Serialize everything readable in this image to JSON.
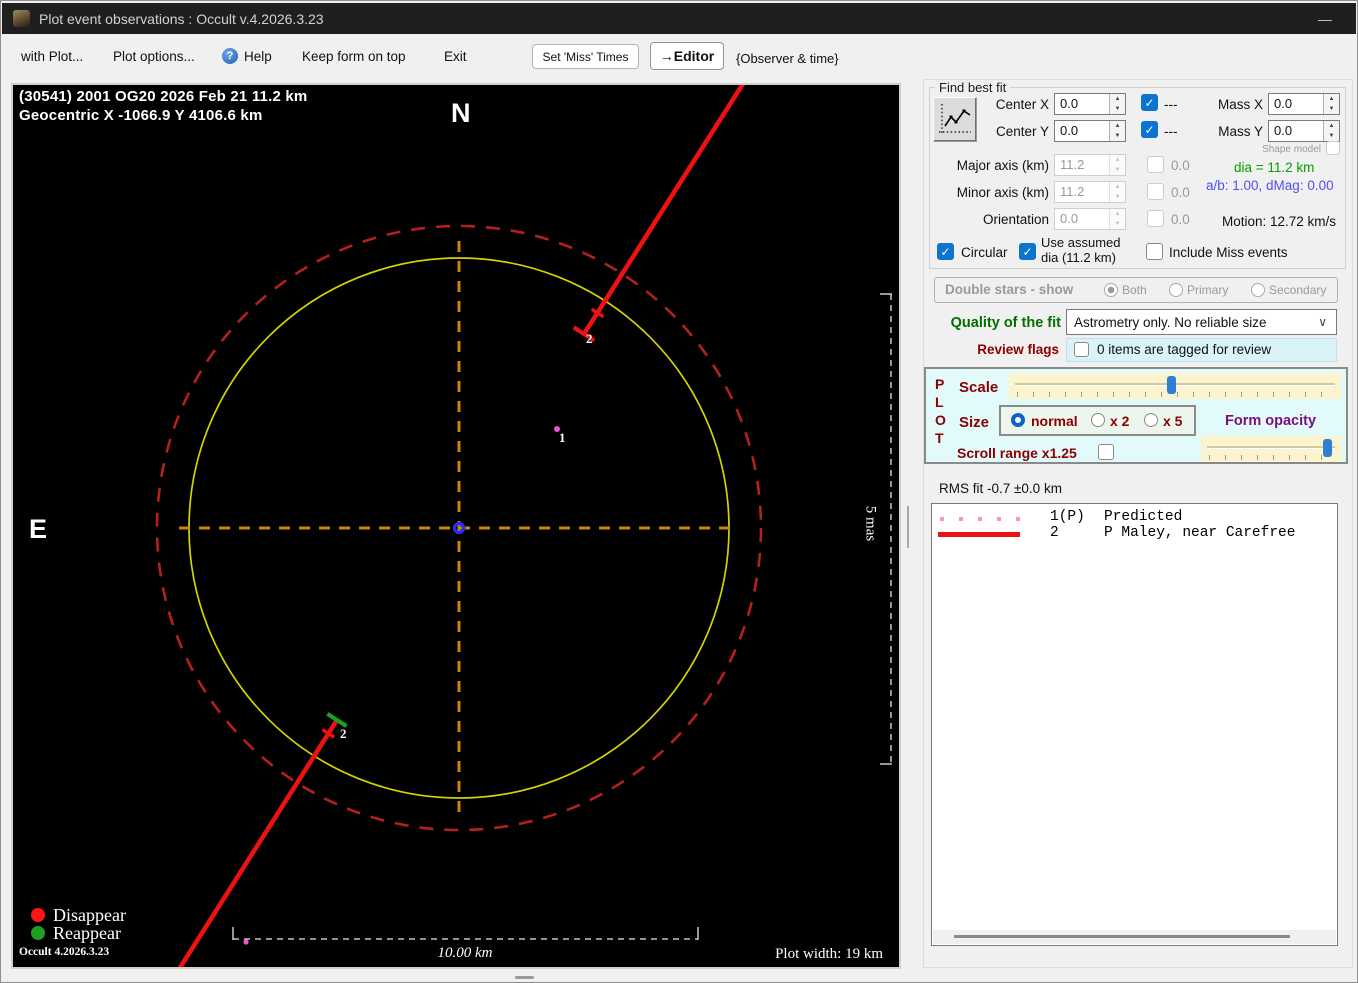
{
  "window": {
    "title": "Plot event observations : Occult v.4.2026.3.23",
    "minimize_glyph": "—"
  },
  "menu": {
    "with_plot": "with Plot...",
    "plot_options": "Plot options...",
    "help_glyph": "?",
    "help": "Help",
    "keep_on_top": "Keep form on top",
    "exit": "Exit",
    "set_miss_times": "Set 'Miss' Times",
    "editor": "→Editor",
    "observer_time": "{Observer & time}"
  },
  "plot": {
    "header_line1": "(30541) 2001 OG20  2026 Feb 21   11.2 km",
    "header_line2": "Geocentric X  -1066.9 Y 4106.6 km",
    "north_label": "N",
    "east_label": "E",
    "station1_label": "1",
    "chord2_label_upper": "2",
    "chord2_label_lower": "2",
    "mas_scale_label": "5 mas",
    "km_scale_label": "10.00 km",
    "plot_width_label": "Plot width: 19 km",
    "disappear_label": "Disappear",
    "reappear_label": "Reappear",
    "version_label": "Occult 4.2026.3.23"
  },
  "find_best_fit": {
    "title": "Find best fit",
    "center_x": {
      "label": "Center X",
      "value": "0.0",
      "flag": "---"
    },
    "center_y": {
      "label": "Center Y",
      "value": "0.0",
      "flag": "---"
    },
    "mass_x": {
      "label": "Mass X",
      "value": "0.0"
    },
    "mass_y": {
      "label": "Mass Y",
      "value": "0.0"
    },
    "shape_model_label": "Shape model",
    "major_axis": {
      "label": "Major axis (km)",
      "value": "11.2",
      "aux": "0.0"
    },
    "minor_axis": {
      "label": "Minor axis (km)",
      "value": "11.2",
      "aux": "0.0"
    },
    "orientation": {
      "label": "Orientation",
      "value": "0.0",
      "aux": "0.0"
    },
    "dia_text": "dia = 11.2 km",
    "ab_text": "a/b: 1.00, dMag: 0.00",
    "motion_text": "Motion: 12.72 km/s",
    "circular_label": "Circular",
    "use_assumed_label": "Use assumed\ndia (11.2 km)",
    "include_miss_label": "Include Miss events"
  },
  "double_stars": {
    "title": "Double stars - show",
    "options": [
      {
        "label": "Both",
        "selected": true
      },
      {
        "label": "Primary",
        "selected": false
      },
      {
        "label": "Secondary",
        "selected": false
      }
    ]
  },
  "quality": {
    "label": "Quality of the fit",
    "value": "Astrometry only. No reliable size"
  },
  "review": {
    "label": "Review flags",
    "status": "0 items are tagged for review"
  },
  "plot_controls": {
    "vertical_title": "P\nL\nO\nT",
    "scale_label": "Scale",
    "size_label": "Size",
    "size_options": [
      {
        "label": "normal",
        "selected": true
      },
      {
        "label": "x 2",
        "selected": false
      },
      {
        "label": "x 5",
        "selected": false
      }
    ],
    "form_opacity_label": "Form opacity",
    "scroll_range_label": "Scroll range x1.25",
    "scale_percent": 48,
    "opacity_percent": 95
  },
  "rms_label": "RMS fit -0.7 ±0.0 km",
  "observations": [
    {
      "id": "1(P)",
      "name": "Predicted",
      "swatch": "dotted-pink"
    },
    {
      "id": "2",
      "name": "P Maley, near Carefree",
      "swatch": "solid-red"
    }
  ],
  "colors": {
    "predicted_pink": "#ff8fc8",
    "chord_red": "#ee1111",
    "disappear_red": "#ff1515",
    "reappear_green": "#1f9e1f",
    "circle_yellow": "#d3d300",
    "limit_circle_red": "#b42020",
    "axis_orange": "#c8860a",
    "center_blue": "#2a2aff",
    "accent_blue": "#0b74d1",
    "dia_green": "#00a000",
    "ab_blue": "#5050f0",
    "label_maroon": "#8b0000",
    "opacity_purple": "#7b0f7b"
  }
}
